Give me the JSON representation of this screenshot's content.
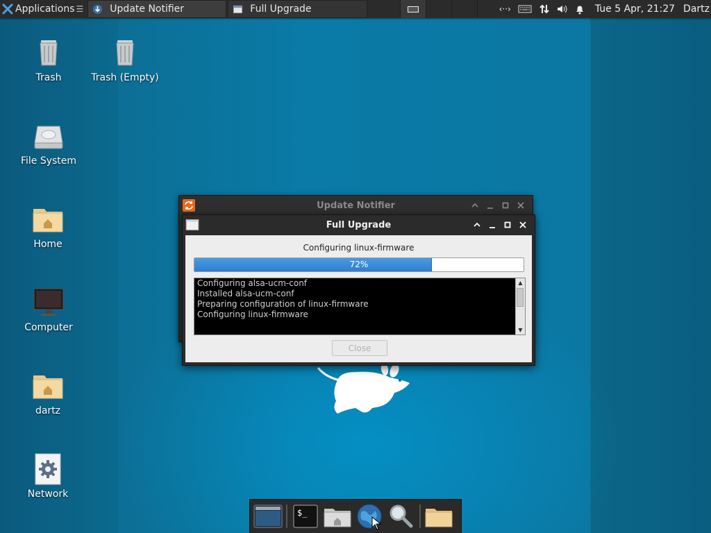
{
  "top_panel": {
    "apps_label": "Applications",
    "tasks": [
      {
        "title": "Update Notifier"
      },
      {
        "title": "Full Upgrade"
      }
    ],
    "clock": "Tue  5 Apr, 21:27",
    "user": "Dartz"
  },
  "desktop": {
    "icons": [
      {
        "label": "Trash"
      },
      {
        "label": "Trash (Empty)"
      },
      {
        "label": "File System"
      },
      {
        "label": "Home"
      },
      {
        "label": "Computer"
      },
      {
        "label": "dartz"
      },
      {
        "label": "Network"
      }
    ]
  },
  "update_notifier": {
    "title": "Update Notifier"
  },
  "full_upgrade": {
    "title": "Full Upgrade",
    "status": "Configuring linux-firmware",
    "progress_percent": 72,
    "progress_text": "72%",
    "log_lines": [
      "Configuring alsa-ucm-conf",
      "Installed alsa-ucm-conf",
      "Preparing configuration of linux-firmware",
      "Configuring linux-firmware"
    ],
    "close_label": "Close"
  },
  "dock": {
    "items": [
      "show-desktop",
      "terminal",
      "home-folder",
      "web-browser",
      "search",
      "files"
    ]
  },
  "colors": {
    "accent": "#3a8dd9",
    "panel": "#2b2b2b",
    "desktop": "#0b73a0"
  }
}
